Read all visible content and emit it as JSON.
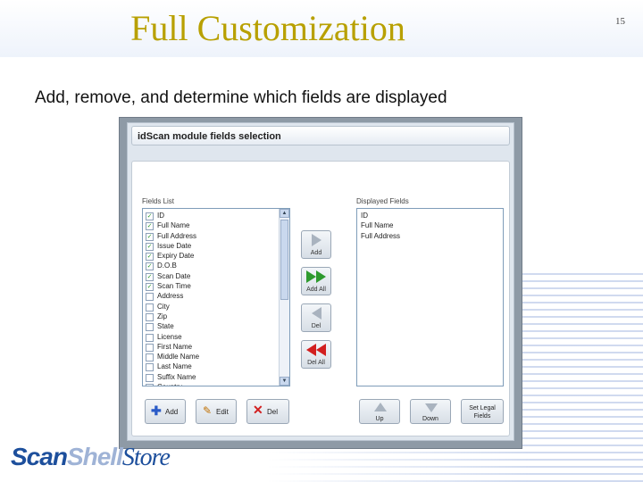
{
  "slide": {
    "title": "Full Customization",
    "number": "15",
    "subtitle": "Add, remove, and determine which fields are displayed"
  },
  "logo": {
    "part1": "Scan",
    "part2": "Shell",
    "part3": "Store"
  },
  "dialog": {
    "title": "idScan module fields selection",
    "fields_list_label": "Fields List",
    "displayed_fields_label": "Displayed Fields",
    "fields_list": [
      {
        "label": "ID",
        "checked": true
      },
      {
        "label": "Full Name",
        "checked": true
      },
      {
        "label": "Full Address",
        "checked": true
      },
      {
        "label": "Issue Date",
        "checked": true
      },
      {
        "label": "Expiry Date",
        "checked": true
      },
      {
        "label": "D.O.B",
        "checked": true
      },
      {
        "label": "Scan Date",
        "checked": true
      },
      {
        "label": "Scan Time",
        "checked": true
      },
      {
        "label": "Address",
        "checked": false
      },
      {
        "label": "City",
        "checked": false
      },
      {
        "label": "Zip",
        "checked": false
      },
      {
        "label": "State",
        "checked": false
      },
      {
        "label": "License",
        "checked": false
      },
      {
        "label": "First Name",
        "checked": false
      },
      {
        "label": "Middle Name",
        "checked": false
      },
      {
        "label": "Last Name",
        "checked": false
      },
      {
        "label": "Suffix Name",
        "checked": false
      },
      {
        "label": "Country",
        "checked": false
      }
    ],
    "displayed_fields": [
      "ID",
      "Full Name",
      "Full Address"
    ],
    "buttons": {
      "add": "Add",
      "add_all": "Add All",
      "del": "Del",
      "del_all": "Del All",
      "bottom_add": "Add",
      "bottom_edit": "Edit",
      "bottom_del": "Del",
      "up": "Up",
      "down": "Down",
      "set_legal_1": "Set Legal",
      "set_legal_2": "Fields"
    },
    "colors": {
      "add_green": "#2e9a2e",
      "del_red": "#d21f1f",
      "disabled_gray": "#a9b3bf",
      "add_blue": "#2a5bc7"
    }
  }
}
